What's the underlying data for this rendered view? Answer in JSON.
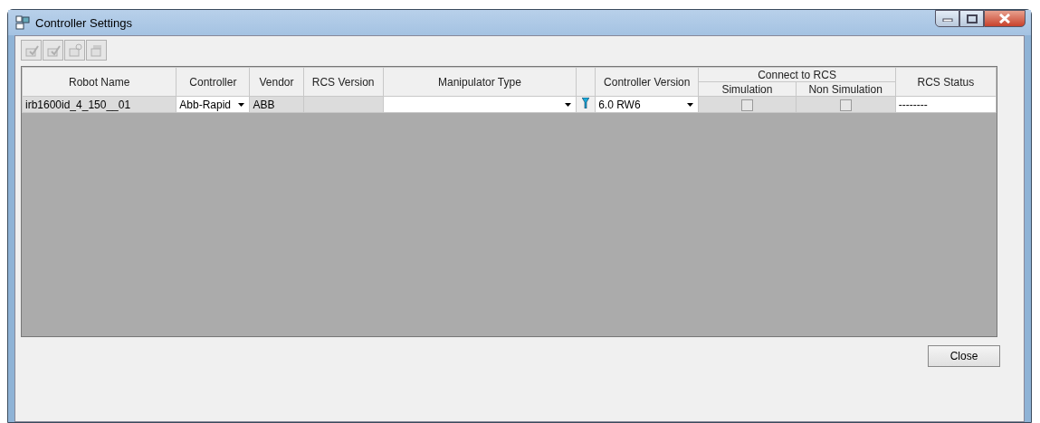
{
  "window": {
    "title": "Controller Settings"
  },
  "toolbar": {
    "buttons": [
      {
        "disabled": true
      },
      {
        "disabled": true
      },
      {
        "disabled": true
      },
      {
        "disabled": true
      }
    ]
  },
  "table": {
    "columns": [
      "Robot Name",
      "Controller",
      "Vendor",
      "RCS Version",
      "Manipulator Type",
      "",
      "Controller Version",
      "RCS Status"
    ],
    "group_header": "Connect to RCS",
    "sub_columns": [
      "Simulation",
      "Non Simulation"
    ],
    "rows": [
      {
        "robot_name": "irb1600id_4_150__01",
        "controller": "Abb-Rapid",
        "vendor": "ABB",
        "manipulator_type": "",
        "controller_version": "6.0 RW6",
        "simulation": {
          "checked": false
        },
        "non_simulation": {
          "checked": false
        },
        "rcs_status": "--------"
      }
    ]
  },
  "buttons": [
    "Close"
  ]
}
